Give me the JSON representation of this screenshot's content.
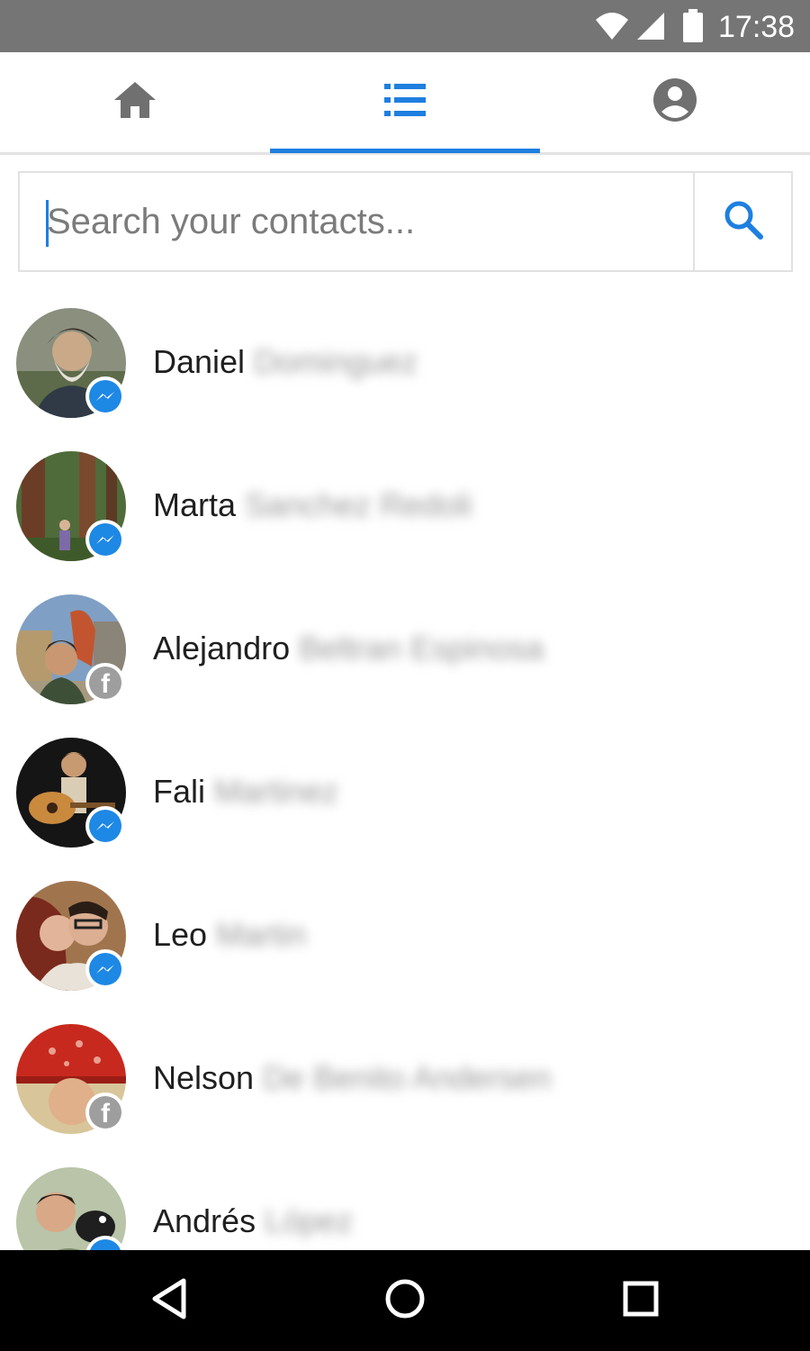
{
  "status_bar": {
    "time": "17:38",
    "icons": [
      "wifi-icon",
      "signal-icon",
      "battery-icon"
    ]
  },
  "tabs": [
    {
      "name": "home",
      "icon": "home-icon",
      "active": false
    },
    {
      "name": "contacts",
      "icon": "list-icon",
      "active": true
    },
    {
      "name": "profile",
      "icon": "account-circle-icon",
      "active": false
    }
  ],
  "search": {
    "placeholder": "Search your contacts...",
    "value": "",
    "button_icon": "search-icon"
  },
  "contacts": [
    {
      "first_name": "Daniel",
      "last_name": "Dominguez",
      "badge": "messenger"
    },
    {
      "first_name": "Marta",
      "last_name": "Sanchez Redoli",
      "badge": "messenger"
    },
    {
      "first_name": "Alejandro",
      "last_name": "Beltran Espinosa",
      "badge": "facebook"
    },
    {
      "first_name": "Fali",
      "last_name": "Martinez",
      "badge": "messenger"
    },
    {
      "first_name": "Leo",
      "last_name": "Martin",
      "badge": "messenger"
    },
    {
      "first_name": "Nelson",
      "last_name": "De Benito Andersen",
      "badge": "facebook"
    },
    {
      "first_name": "Andrés",
      "last_name": "López",
      "badge": "messenger"
    }
  ],
  "nav_bar": {
    "buttons": [
      "back-icon",
      "home-circle-icon",
      "recents-icon"
    ]
  },
  "colors": {
    "accent": "#1e7fe0",
    "status_bar": "#757575",
    "messenger_badge": "#1e88e5",
    "facebook_badge": "#9e9e9e",
    "nav_bar": "#000000"
  }
}
